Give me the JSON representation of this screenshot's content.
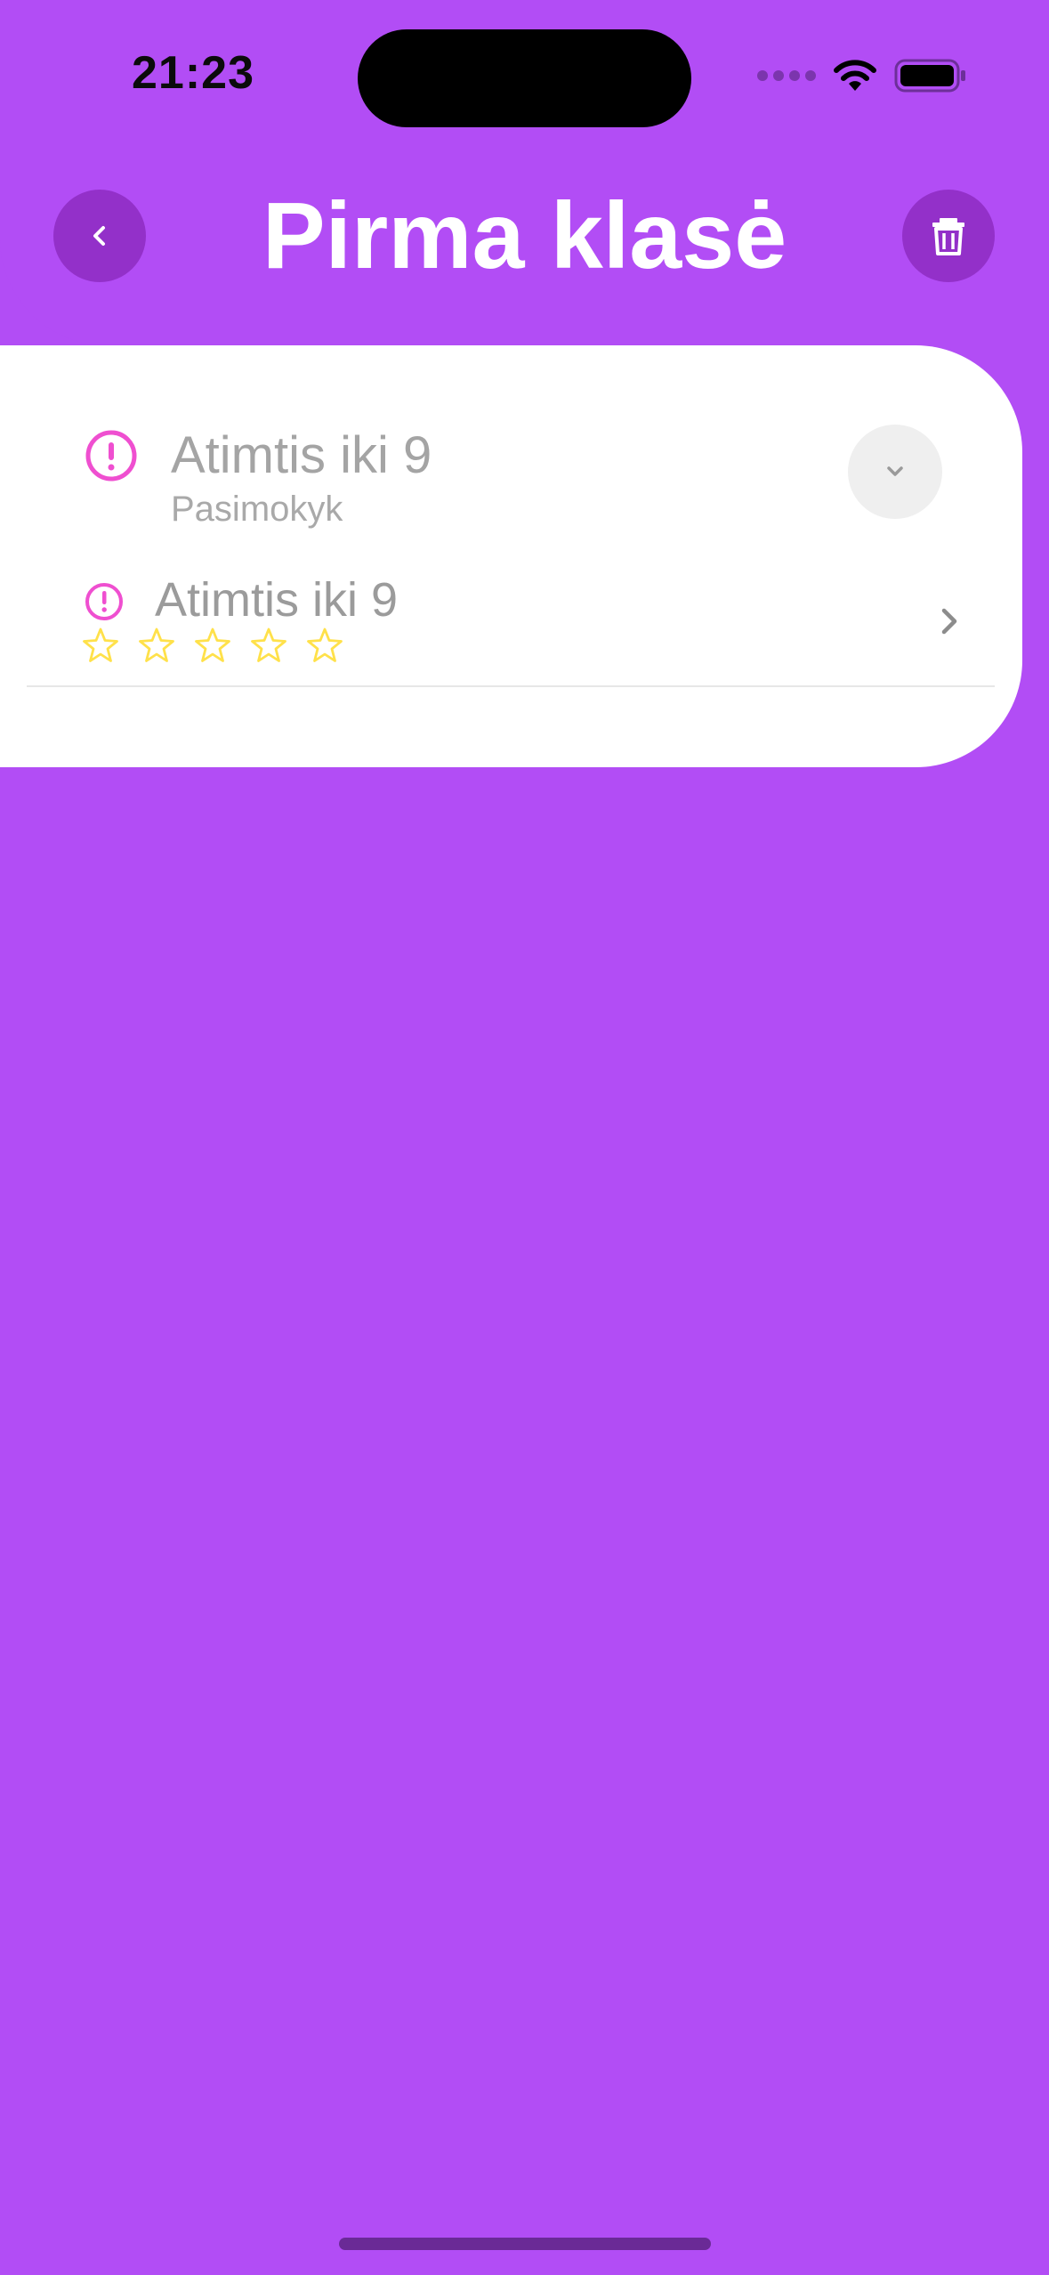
{
  "status_bar": {
    "time": "21:23",
    "wifi_icon": "wifi-icon",
    "battery_icon": "battery-icon"
  },
  "header": {
    "title": "Pirma klasė",
    "back_icon": "chevron-left-icon",
    "delete_icon": "trash-icon"
  },
  "list": {
    "items": [
      {
        "title": "Atimtis iki 9",
        "subtitle": "Pasimokyk",
        "status_icon": "alert-circle-icon",
        "action_icon": "chevron-down-icon"
      },
      {
        "title": "Atimtis iki 9",
        "status_icon": "alert-circle-icon",
        "stars_filled": 0,
        "stars_total": 5,
        "action_icon": "chevron-right-icon"
      }
    ]
  },
  "colors": {
    "background": "#b24df5",
    "header_button": "#9330c9",
    "card": "#ffffff",
    "alert_icon": "#ef4fd0",
    "star": "#ffe14a",
    "text_muted": "#a4a4a4"
  }
}
